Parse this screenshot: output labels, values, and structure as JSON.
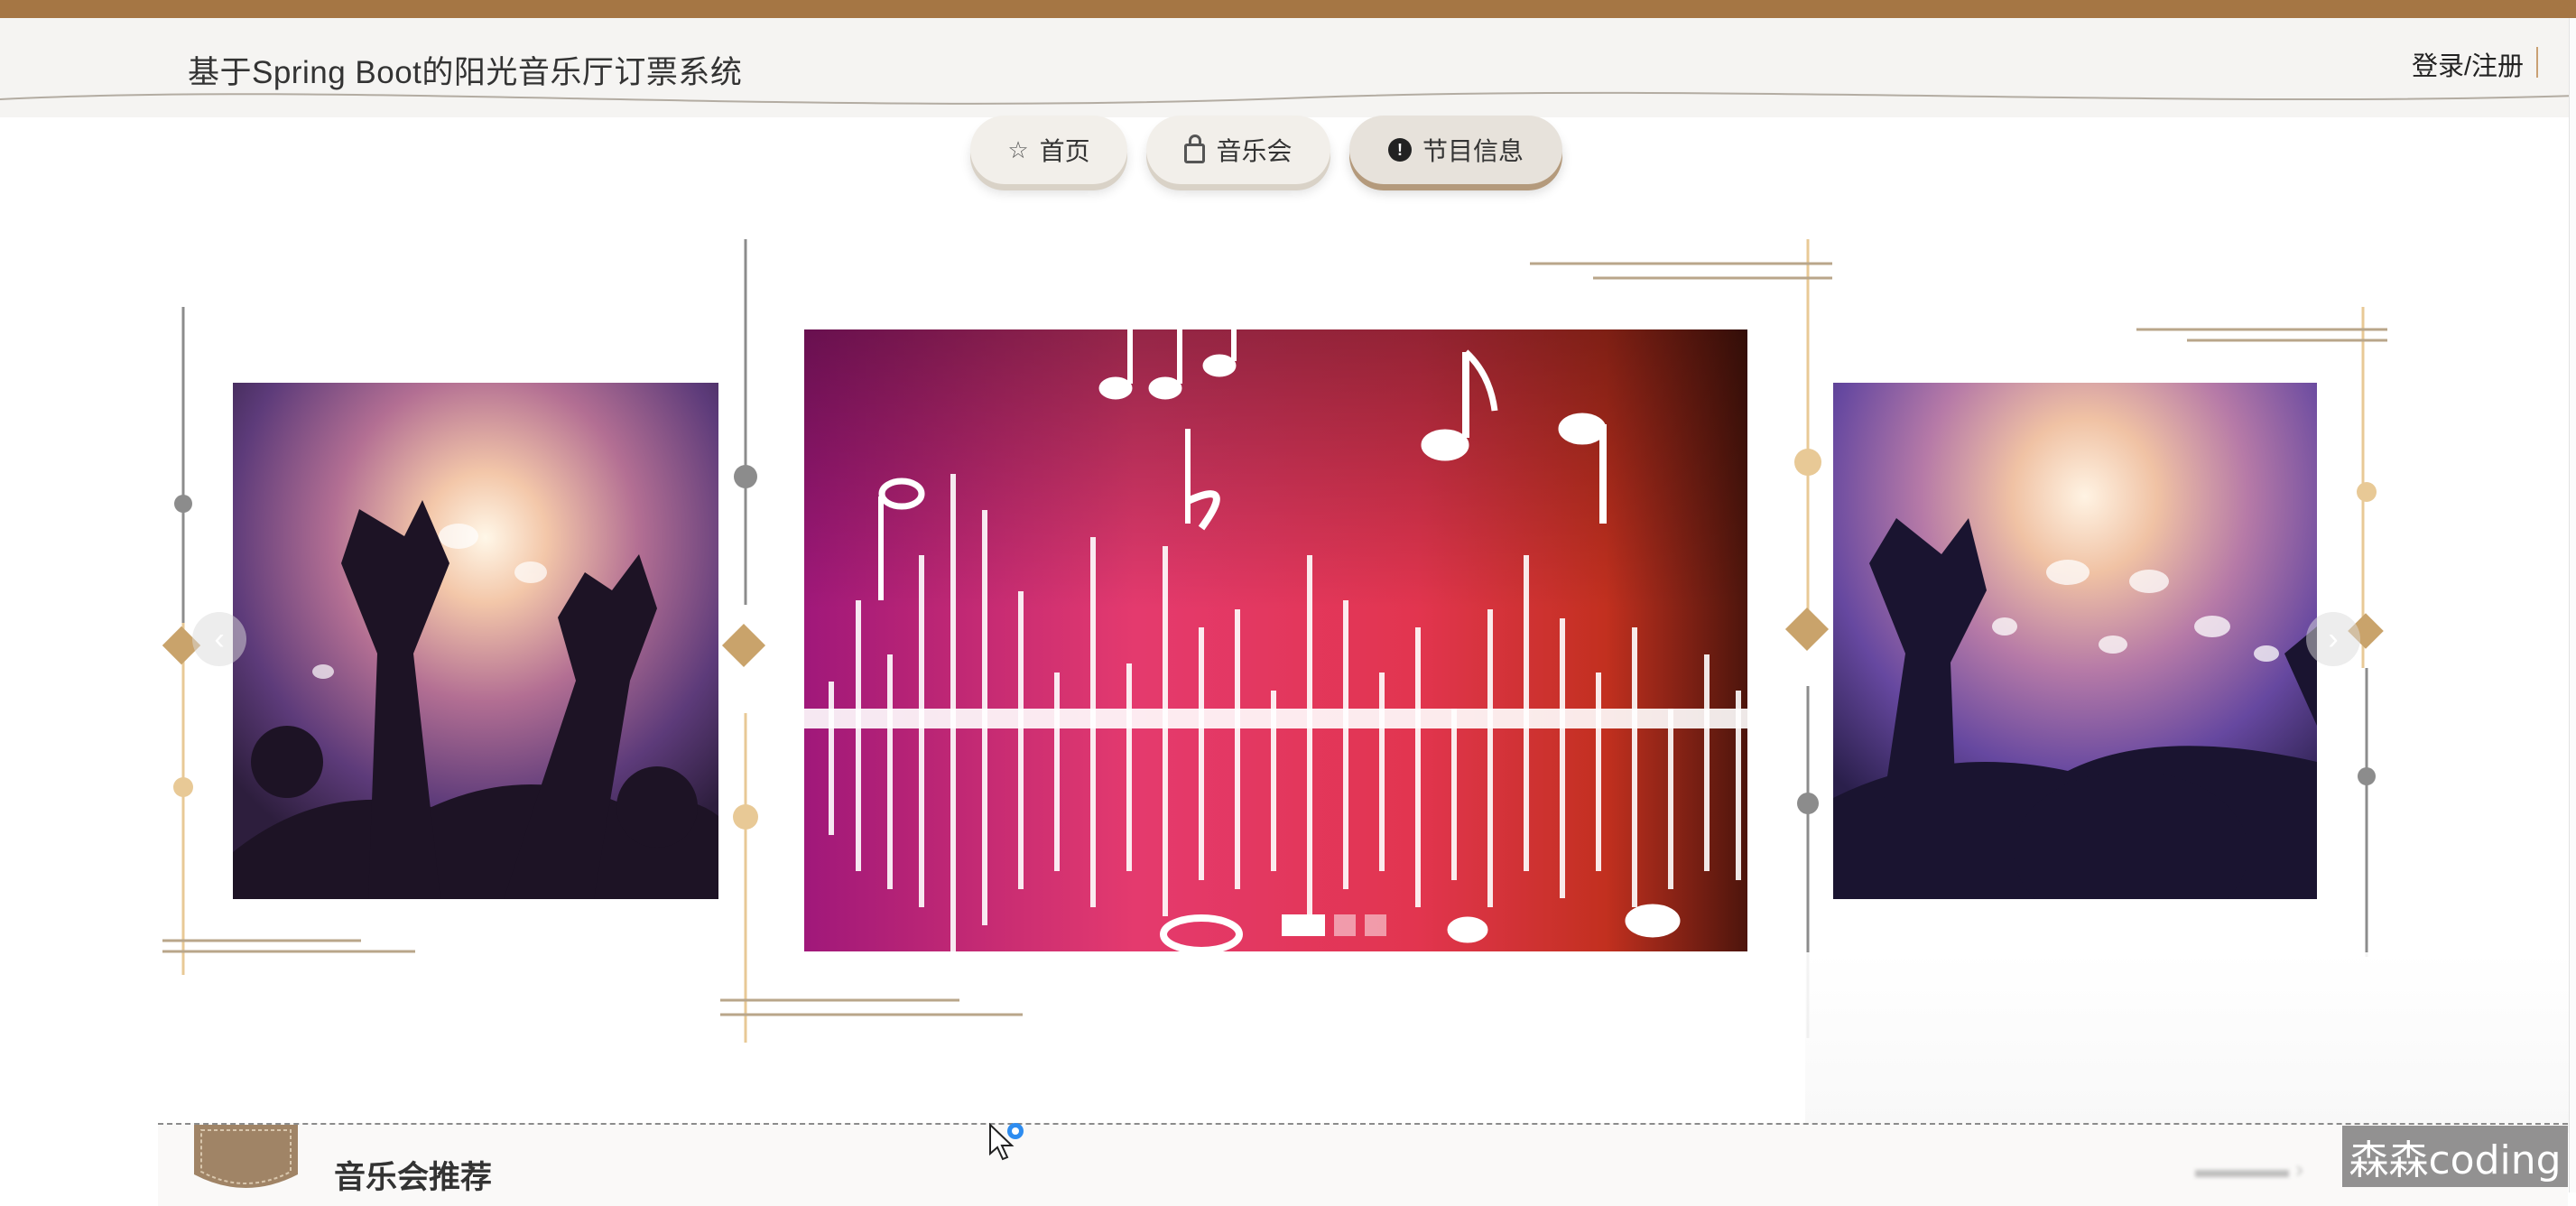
{
  "header": {
    "site_title": "基于Spring Boot的阳光音乐厅订票系统",
    "login_link": "登录/注册"
  },
  "nav": {
    "items": [
      {
        "label": "首页",
        "icon": "star-icon"
      },
      {
        "label": "音乐会",
        "icon": "lock-icon"
      },
      {
        "label": "节目信息",
        "icon": "info-circle-icon",
        "active": true
      }
    ]
  },
  "carousel": {
    "slides": [
      "concert-crowd",
      "music-soundwave",
      "concert-crowd"
    ],
    "dot_count": 3,
    "active_dot": 0
  },
  "section": {
    "title": "音乐会推荐"
  },
  "watermark": "森森coding",
  "colors": {
    "brand_brown": "#a57644",
    "gold_accent": "#c9a36b",
    "header_bg": "#f5f4f2"
  }
}
